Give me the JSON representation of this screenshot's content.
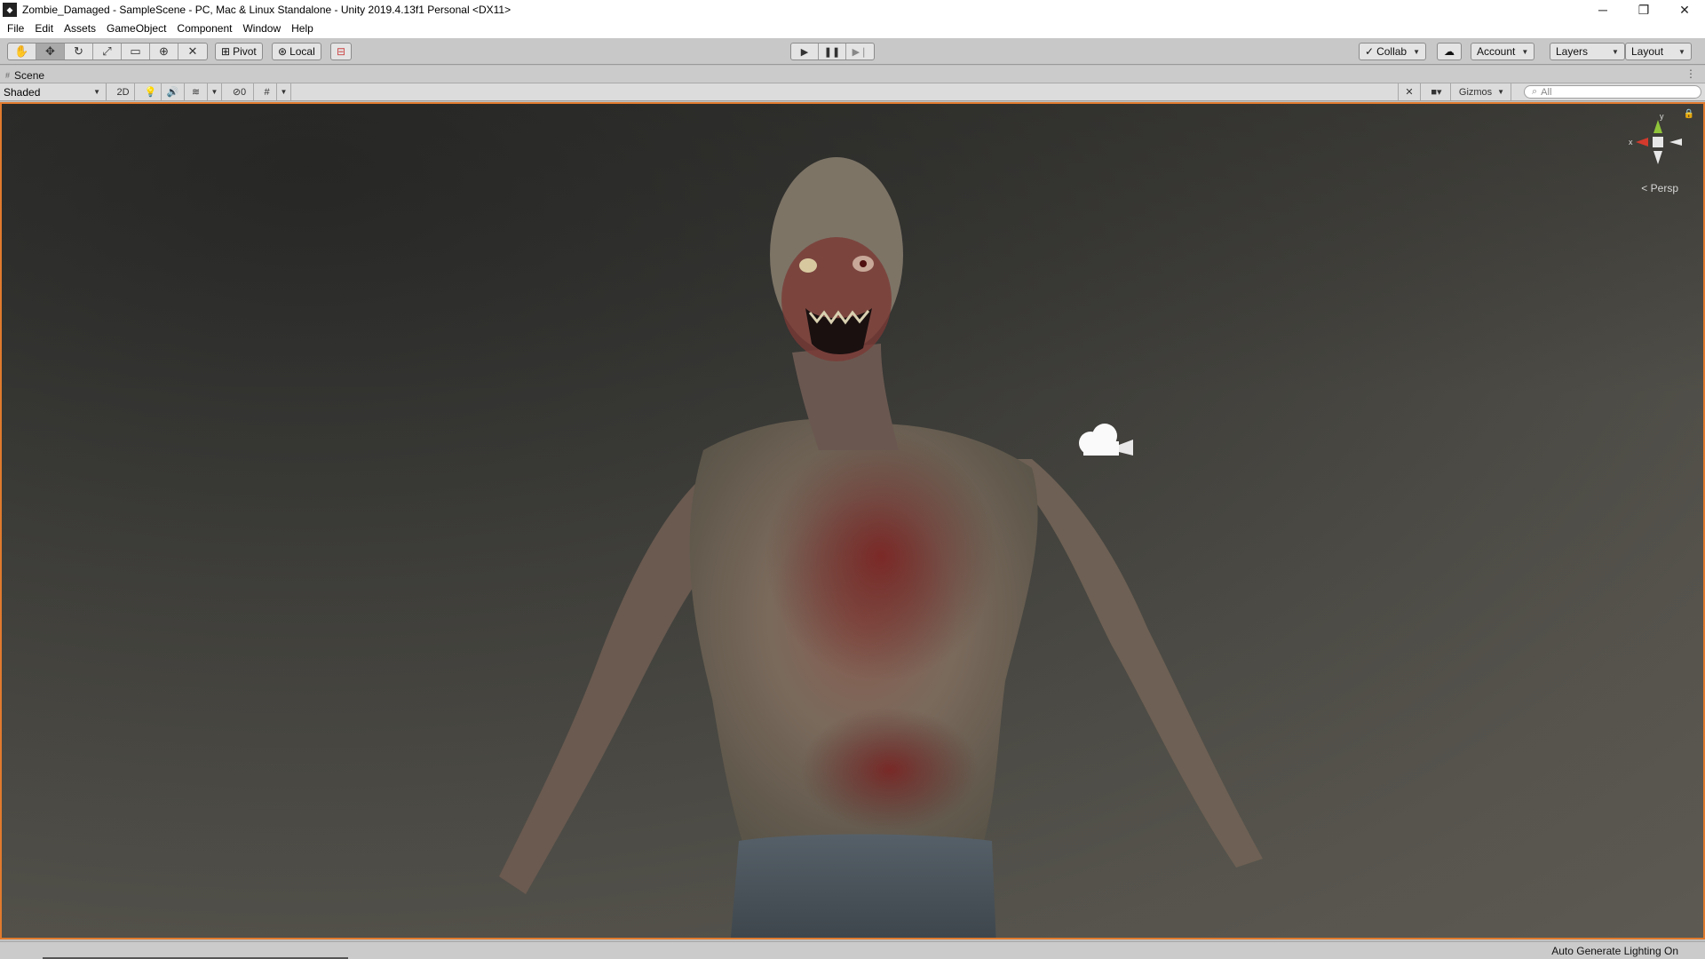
{
  "window": {
    "title": "Zombie_Damaged - SampleScene - PC, Mac & Linux Standalone - Unity 2019.4.13f1 Personal <DX11>",
    "controls": {
      "minimize": "─",
      "maximize": "❐",
      "close": "✕"
    }
  },
  "menu": [
    "File",
    "Edit",
    "Assets",
    "GameObject",
    "Component",
    "Window",
    "Help"
  ],
  "toolbar": {
    "tools": [
      "hand-tool",
      "move-tool",
      "rotate-tool",
      "scale-tool",
      "rect-tool",
      "transform-tool",
      "custom-tool"
    ],
    "active_tool": "move-tool",
    "pivot_label": "Pivot",
    "local_label": "Local",
    "collab_label": "Collab",
    "account_label": "Account",
    "layers_label": "Layers",
    "layout_label": "Layout"
  },
  "scene_tab": {
    "label": "Scene"
  },
  "scene_toolbar": {
    "draw_mode": "Shaded",
    "mode_2d": "2D",
    "hidden_count": "0",
    "gizmos_label": "Gizmos",
    "search_placeholder": "All"
  },
  "viewport": {
    "projection_label": "Persp",
    "gizmo_axes": {
      "x": "x",
      "y": "y"
    }
  },
  "status": {
    "message": "Auto Generate Lighting On"
  },
  "colors": {
    "accent_border": "#e07a2e",
    "x_axis": "#d33a2c",
    "y_axis": "#8fc43a",
    "z_axis": "#4a7bd3"
  }
}
